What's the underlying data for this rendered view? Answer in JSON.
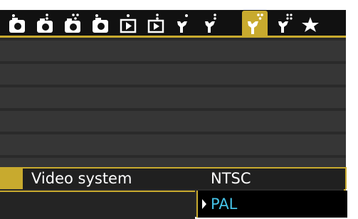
{
  "tabs": [
    {
      "name": "shoot-1",
      "icon": "camera-icon",
      "dots": 1
    },
    {
      "name": "shoot-2",
      "icon": "camera-icon",
      "dots": 2
    },
    {
      "name": "shoot-3",
      "icon": "camera-icon",
      "dots": 3
    },
    {
      "name": "shoot-4",
      "icon": "camera-icon",
      "dots": 4
    },
    {
      "name": "playback-1",
      "icon": "playback-icon",
      "dots": 1
    },
    {
      "name": "playback-2",
      "icon": "playback-icon",
      "dots": 2
    },
    {
      "name": "setup-1",
      "icon": "wrench-icon",
      "dots": 1
    },
    {
      "name": "setup-2",
      "icon": "wrench-icon",
      "dots": 2
    },
    {
      "name": "setup-3",
      "icon": "wrench-icon",
      "dots": 3,
      "active": true
    },
    {
      "name": "setup-4",
      "icon": "wrench-icon",
      "dots": 4
    },
    {
      "name": "my-menu",
      "icon": "star-icon",
      "dots": 0
    }
  ],
  "menu": {
    "selected_item": {
      "label": "Video system",
      "value": "NTSC"
    },
    "dropdown": {
      "options": [
        {
          "label": "PAL",
          "highlighted": true
        }
      ]
    }
  },
  "colors": {
    "accent": "#c8aa2e",
    "highlight_text": "#45c2e6",
    "tab_background": "#111111",
    "row_background": "#363636"
  }
}
